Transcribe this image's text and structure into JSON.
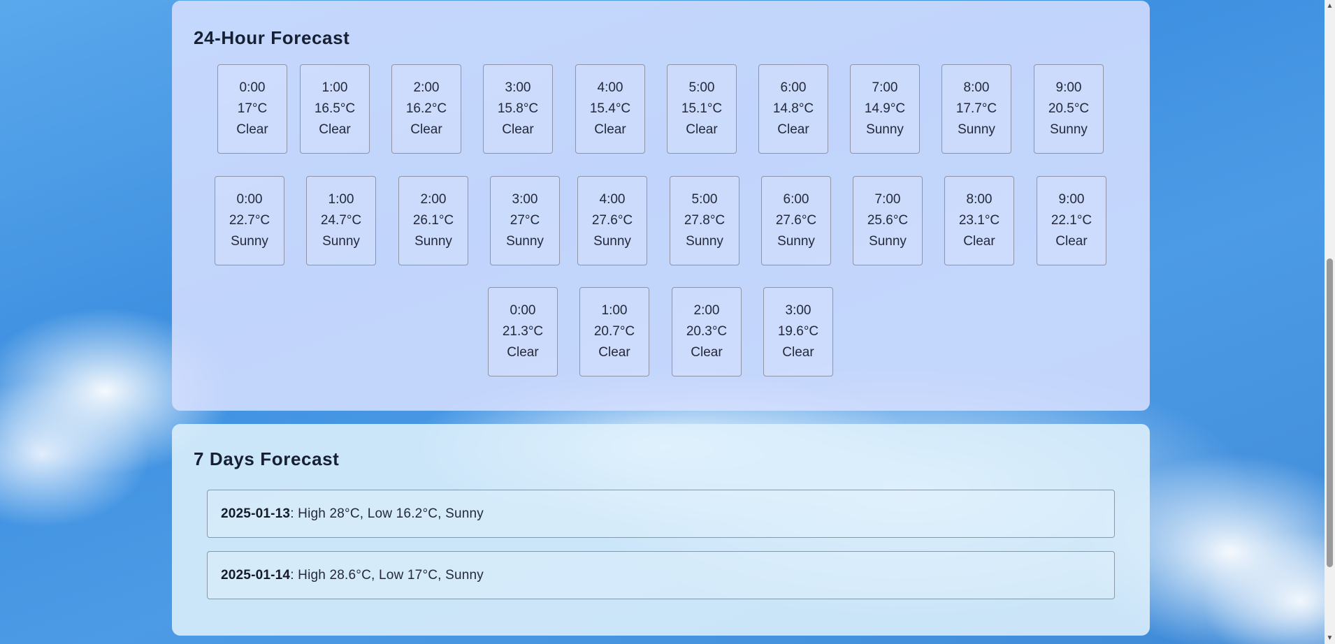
{
  "hourly_section": {
    "title": "24-Hour Forecast",
    "rows": [
      [
        {
          "time": "0:00",
          "temp": "17°C",
          "condition": "Clear"
        },
        {
          "time": "1:00",
          "temp": "16.5°C",
          "condition": "Clear"
        },
        {
          "time": "2:00",
          "temp": "16.2°C",
          "condition": "Clear"
        },
        {
          "time": "3:00",
          "temp": "15.8°C",
          "condition": "Clear"
        },
        {
          "time": "4:00",
          "temp": "15.4°C",
          "condition": "Clear"
        },
        {
          "time": "5:00",
          "temp": "15.1°C",
          "condition": "Clear"
        },
        {
          "time": "6:00",
          "temp": "14.8°C",
          "condition": "Clear"
        },
        {
          "time": "7:00",
          "temp": "14.9°C",
          "condition": "Sunny"
        },
        {
          "time": "8:00",
          "temp": "17.7°C",
          "condition": "Sunny"
        },
        {
          "time": "9:00",
          "temp": "20.5°C",
          "condition": "Sunny"
        }
      ],
      [
        {
          "time": "0:00",
          "temp": "22.7°C",
          "condition": "Sunny"
        },
        {
          "time": "1:00",
          "temp": "24.7°C",
          "condition": "Sunny"
        },
        {
          "time": "2:00",
          "temp": "26.1°C",
          "condition": "Sunny"
        },
        {
          "time": "3:00",
          "temp": "27°C",
          "condition": "Sunny"
        },
        {
          "time": "4:00",
          "temp": "27.6°C",
          "condition": "Sunny"
        },
        {
          "time": "5:00",
          "temp": "27.8°C",
          "condition": "Sunny"
        },
        {
          "time": "6:00",
          "temp": "27.6°C",
          "condition": "Sunny"
        },
        {
          "time": "7:00",
          "temp": "25.6°C",
          "condition": "Sunny"
        },
        {
          "time": "8:00",
          "temp": "23.1°C",
          "condition": "Clear"
        },
        {
          "time": "9:00",
          "temp": "22.1°C",
          "condition": "Clear"
        }
      ],
      [
        {
          "time": "0:00",
          "temp": "21.3°C",
          "condition": "Clear"
        },
        {
          "time": "1:00",
          "temp": "20.7°C",
          "condition": "Clear"
        },
        {
          "time": "2:00",
          "temp": "20.3°C",
          "condition": "Clear"
        },
        {
          "time": "3:00",
          "temp": "19.6°C",
          "condition": "Clear"
        }
      ]
    ]
  },
  "daily_section": {
    "title": "7 Days Forecast",
    "days": [
      {
        "date": "2025-01-13",
        "summary": ": High 28°C, Low 16.2°C, Sunny"
      },
      {
        "date": "2025-01-14",
        "summary": ": High 28.6°C, Low 17°C, Sunny"
      }
    ]
  },
  "scrollbar": {
    "up_icon": "triangle-up-icon",
    "down_icon": "triangle-down-icon"
  }
}
